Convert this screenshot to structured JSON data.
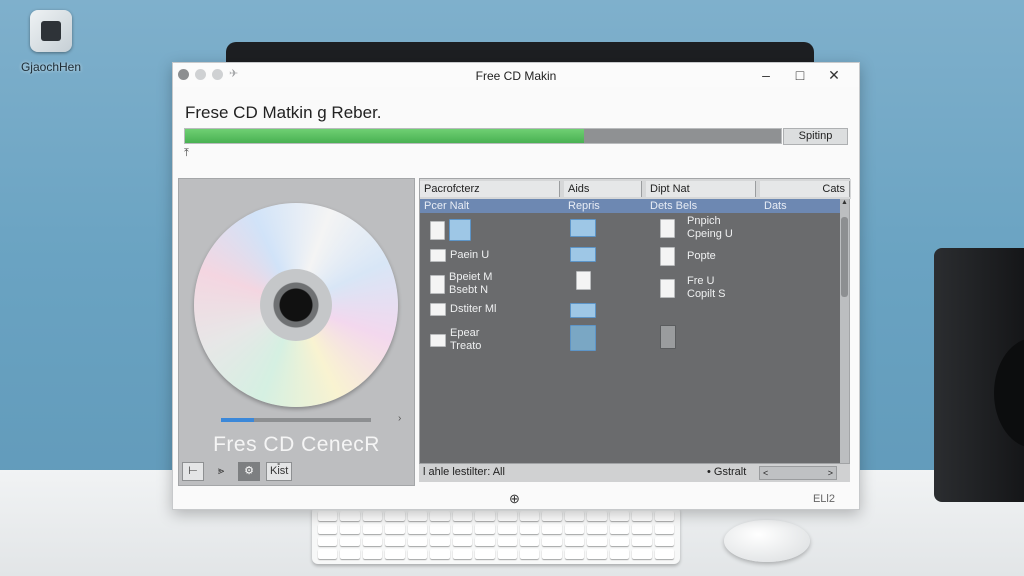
{
  "desktop": {
    "icon_label": "GjaochHen"
  },
  "window": {
    "title": "Free CD Makin",
    "controls": {
      "minimize": "–",
      "maximize": "□",
      "close": "✕"
    },
    "heading": "Frese CD Matkin g Reber.",
    "progress": {
      "value_pct": 67,
      "button_label": "Spitinp"
    },
    "small_icon": "⤒"
  },
  "disc_panel": {
    "caption": "Fres CD CenecR",
    "bar_progress_pct": 22,
    "bar_end": "›",
    "tools": [
      "⊢",
      "⪢",
      "⚙",
      "Ki̊st"
    ]
  },
  "file_browser": {
    "columns": [
      "Pacrofcterz",
      "Aids",
      "Dipt  Nat",
      "Cats"
    ],
    "selected_row": [
      "Pcer  Nalt",
      "Repris",
      "Dets  Bels",
      "Dats"
    ],
    "items_col1": [
      {
        "label": "",
        "icon": "file-icon"
      },
      {
        "label": "Paein U",
        "icon": "file-icon"
      },
      {
        "label": "Bpeiet M\nBsebt N",
        "icon": "file-icon"
      },
      {
        "label": "Dstiter Ml",
        "icon": "file-icon"
      },
      {
        "label": "Epear\nTreato",
        "icon": "folder-icon"
      }
    ],
    "items_col3": [
      {
        "label": "Pnpich\nCpeing U",
        "icon": "file-icon"
      },
      {
        "label": "Popte",
        "icon": "file-icon"
      },
      {
        "label": "Fre U\nCopilt S",
        "icon": "file-icon"
      }
    ],
    "status_left": "l ahle lestilter:  All",
    "status_right": "• Gstralt",
    "hscroll_left": "<",
    "hscroll_right": ">"
  },
  "footer": {
    "icon": "⊕",
    "text": "ELl2"
  }
}
